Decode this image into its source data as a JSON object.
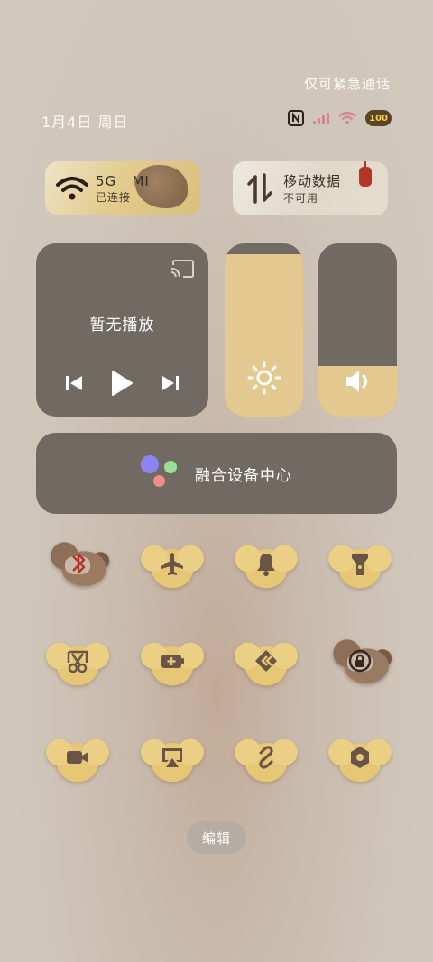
{
  "status_bar": {
    "emergency_text": "仅可紧急通话",
    "date_text": "1月4日 周日",
    "battery_level": "100",
    "icons": [
      "nfc-icon",
      "signal-icon",
      "wifi-icon",
      "battery-icon"
    ]
  },
  "tiles": {
    "wifi": {
      "label": "5G   MI",
      "status": "已连接",
      "icon": "wifi-icon"
    },
    "mobile_data": {
      "label": "移动数据",
      "status": "不可用",
      "icon": "mobile-data-icon"
    }
  },
  "media": {
    "title": "暂无播放",
    "icons": [
      "cast-icon",
      "previous-icon",
      "play-icon",
      "next-icon"
    ]
  },
  "sliders": {
    "brightness": {
      "icon": "brightness-icon",
      "level": 0.94
    },
    "volume": {
      "icon": "volume-icon",
      "level": 0.29
    }
  },
  "device_center": {
    "label": "融合设备中心",
    "dot_colors": [
      "#8e83f2",
      "#9adf94",
      "#f08d86"
    ]
  },
  "quick_toggles": [
    {
      "icon": "bluetooth-icon",
      "style": "horse"
    },
    {
      "icon": "airplane-icon",
      "style": "cloud"
    },
    {
      "icon": "bell-icon",
      "style": "cloud"
    },
    {
      "icon": "flashlight-icon",
      "style": "cloud"
    },
    {
      "icon": "screenshot-icon",
      "style": "cloud"
    },
    {
      "icon": "battery-saver-icon",
      "style": "cloud"
    },
    {
      "icon": "share-icon",
      "style": "cloud"
    },
    {
      "icon": "rotation-lock-icon",
      "style": "horse"
    },
    {
      "icon": "screen-record-icon",
      "style": "cloud"
    },
    {
      "icon": "screen-cast-icon",
      "style": "cloud"
    },
    {
      "icon": "link-icon",
      "style": "cloud"
    },
    {
      "icon": "settings-icon",
      "style": "cloud"
    }
  ],
  "edit_label": "编辑",
  "colors": {
    "panel": "#706a63",
    "accent_gold": "#e3c98f",
    "icon_brown": "#6a5448"
  }
}
